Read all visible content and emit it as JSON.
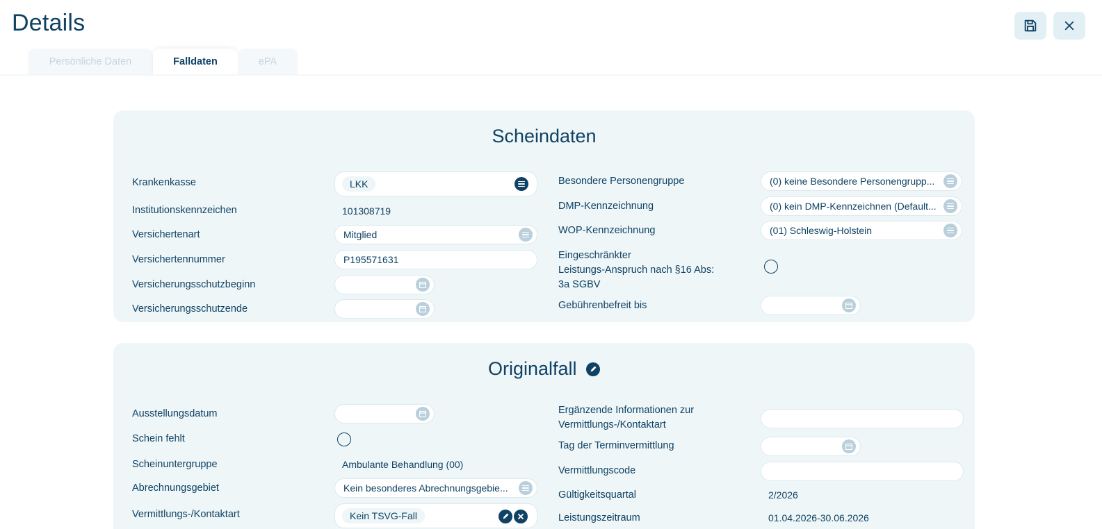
{
  "header": {
    "title": "Details",
    "save_icon": "save-icon",
    "close_icon": "close-icon"
  },
  "tabs": [
    {
      "label": "Persönliche Daten",
      "active": false
    },
    {
      "label": "Falldaten",
      "active": true
    },
    {
      "label": "ePA",
      "active": false
    }
  ],
  "scheindaten": {
    "title": "Scheindaten",
    "left": {
      "krankenkasse": {
        "label": "Krankenkasse",
        "value": "LKK"
      },
      "ik": {
        "label": "Institutionskennzeichen",
        "value": "101308719"
      },
      "versichertenart": {
        "label": "Versichertenart",
        "value": "Mitglied"
      },
      "versichertennummer": {
        "label": "Versichertennummer",
        "value": "P195571631"
      },
      "schutzbeginn": {
        "label": "Versicherungsschutzbeginn",
        "value": ""
      },
      "schutzende": {
        "label": "Versicherungsschutzende",
        "value": ""
      }
    },
    "right": {
      "personengruppe": {
        "label": "Besondere Personengruppe",
        "value": "(0) keine Besondere Personengrupp..."
      },
      "dmp": {
        "label": "DMP-Kennzeichnung",
        "value": "(0) kein DMP-Kennzeichnen (Default..."
      },
      "wop": {
        "label": "WOP-Kennzeichnung",
        "value": "(01) Schleswig-Holstein"
      },
      "eingeschraenkt": {
        "label_line1": "Eingeschränkter",
        "label_line2": "Leistungs-Anspruch nach §16 Abs:",
        "label_line3": "3a SGBV",
        "checked": false
      },
      "gebuehrenbefreit": {
        "label": "Gebührenbefreit bis",
        "value": ""
      }
    }
  },
  "originalfall": {
    "title": "Originalfall",
    "left": {
      "ausstellungsdatum": {
        "label": "Ausstellungsdatum",
        "value": ""
      },
      "schein_fehlt": {
        "label": "Schein fehlt",
        "checked": false
      },
      "scheinuntergruppe": {
        "label": "Scheinuntergruppe",
        "value": "Ambulante Behandlung (00)"
      },
      "abrechnungsgebiet": {
        "label": "Abrechnungsgebiet",
        "value": "Kein besonderes Abrechnungsgebie..."
      },
      "kontaktart": {
        "label": "Vermittlungs-/Kontaktart",
        "value": "Kein TSVG-Fall"
      }
    },
    "right": {
      "ergaenzende": {
        "label_line1": "Ergänzende Informationen zur",
        "label_line2": "Vermittlungs-/Kontaktart",
        "value": ""
      },
      "terminvermittlung": {
        "label": "Tag der Terminvermittlung",
        "value": ""
      },
      "vermittlungscode": {
        "label": "Vermittlungscode",
        "value": ""
      },
      "gueltigkeitsquartal": {
        "label": "Gültigkeitsquartal",
        "value": "2/2026"
      },
      "leistungszeitraum": {
        "label": "Leistungszeitraum",
        "value": "01.04.2026-30.06.2026"
      }
    }
  }
}
